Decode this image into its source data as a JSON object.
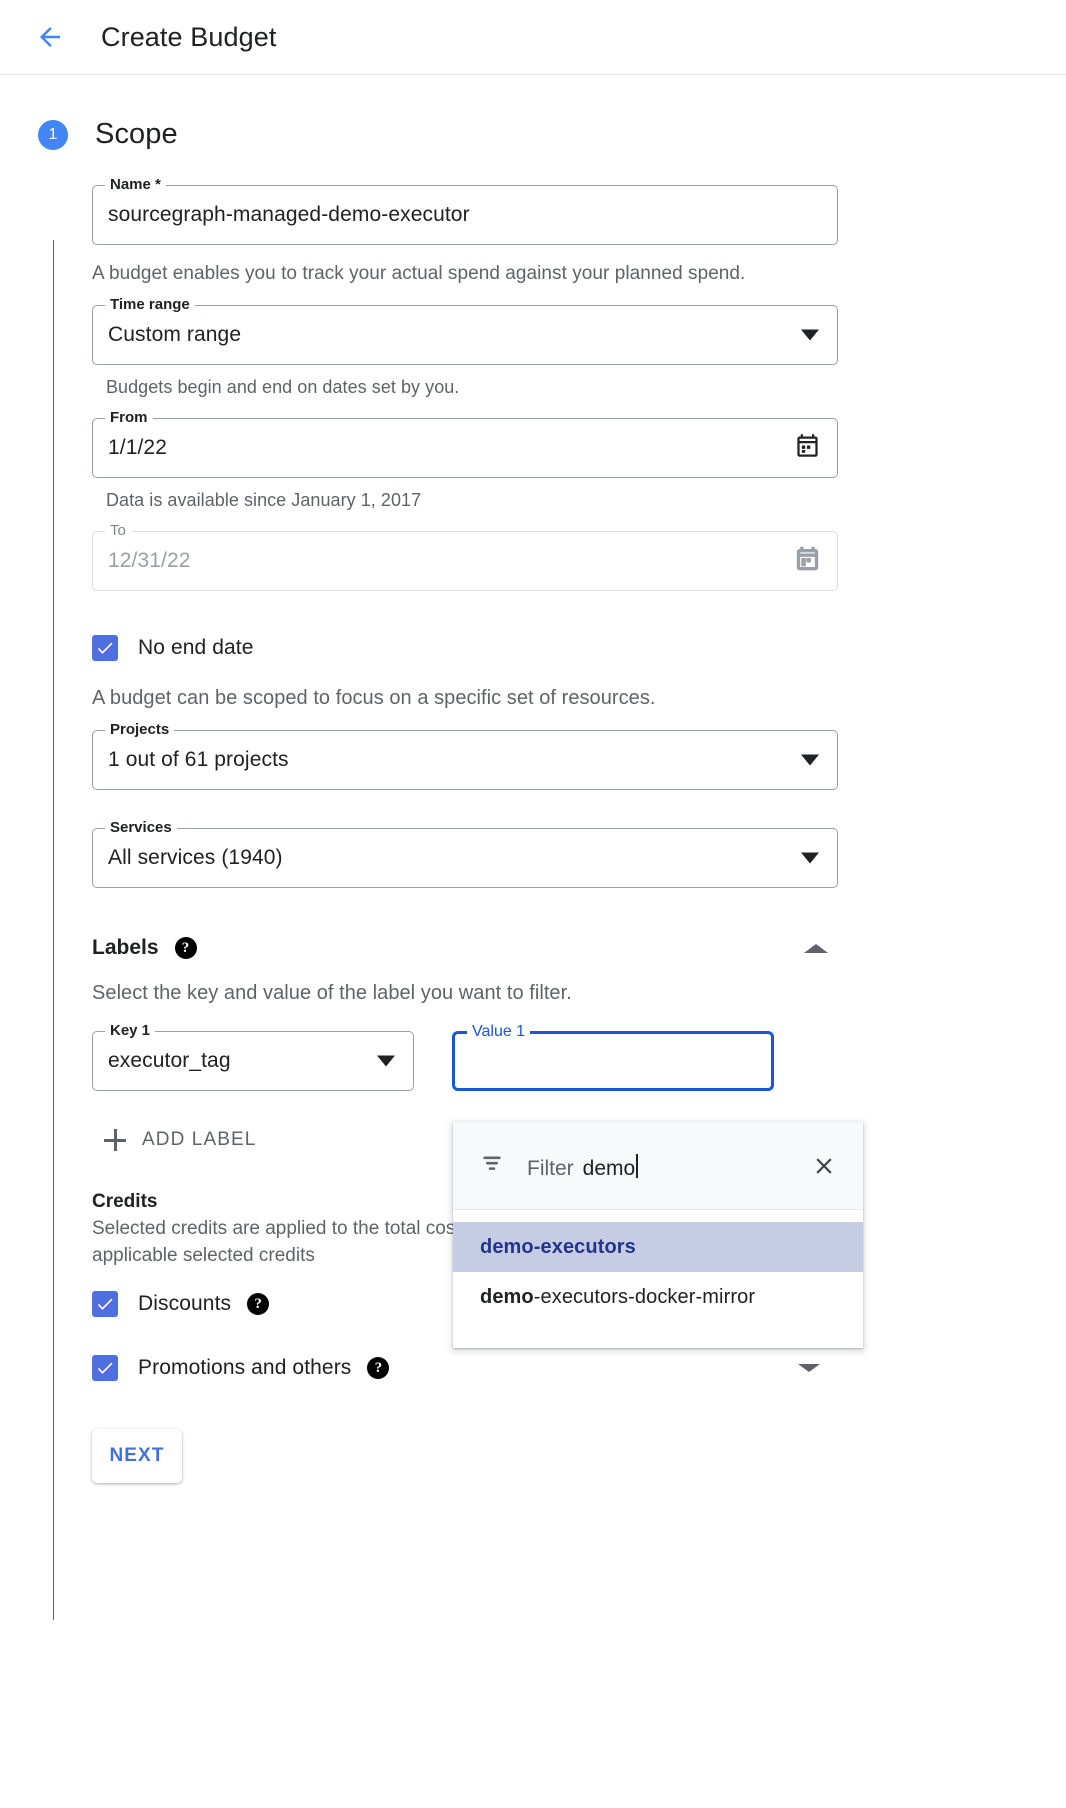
{
  "appbar": {
    "back_icon": "arrow-back-icon",
    "title": "Create Budget"
  },
  "step": {
    "number": "1",
    "title": "Scope"
  },
  "fields": {
    "name": {
      "label": "Name *",
      "value": "sourcegraph-managed-demo-executor"
    },
    "name_helper": "A budget enables you to track your actual spend against your planned spend.",
    "time_range": {
      "label": "Time range",
      "value": "Custom range"
    },
    "time_range_helper": "Budgets begin and end on dates set by you.",
    "from": {
      "label": "From",
      "value": "1/1/22"
    },
    "from_helper": "Data is available since January 1, 2017",
    "to": {
      "label": "To",
      "value": "12/31/22"
    },
    "no_end_date": {
      "label": "No end date",
      "checked": true
    },
    "scope_note": "A budget can be scoped to focus on a specific set of resources.",
    "projects": {
      "label": "Projects",
      "value": "1 out of 61 projects"
    },
    "services": {
      "label": "Services",
      "value": "All services (1940)"
    }
  },
  "labels": {
    "title": "Labels",
    "help_glyph": "?",
    "description": "Select the key and value of the label you want to filter.",
    "key": {
      "label": "Key 1",
      "value": "executor_tag"
    },
    "value": {
      "label": "Value 1",
      "value": ""
    },
    "add_label": "ADD LABEL"
  },
  "dropdown": {
    "filter_placeholder": "Filter",
    "filter_typed": "demo",
    "close_icon": "close-icon",
    "filter_icon": "filter-list-icon",
    "options": [
      {
        "prefix": "demo",
        "rest": "-executors",
        "full": "demo-executors",
        "selected": true
      },
      {
        "prefix": "demo",
        "rest": "-executors-docker-mirror",
        "full": "demo-executors-docker-mirror",
        "selected": false
      }
    ]
  },
  "credits": {
    "title": "Credits",
    "description_line1": "Selected credits are applied to the total cost",
    "description_line2": "applicable selected credits",
    "discounts": {
      "label": "Discounts",
      "checked": true
    },
    "promotions": {
      "label": "Promotions and others",
      "checked": true
    }
  },
  "actions": {
    "next": "NEXT"
  },
  "colors": {
    "accent_blue": "#4285f4",
    "checkbox_blue": "#4f6ee0",
    "focus_blue": "#1a56d6",
    "option_selected_bg": "#c6cce4",
    "option_selected_text": "#24348c"
  }
}
